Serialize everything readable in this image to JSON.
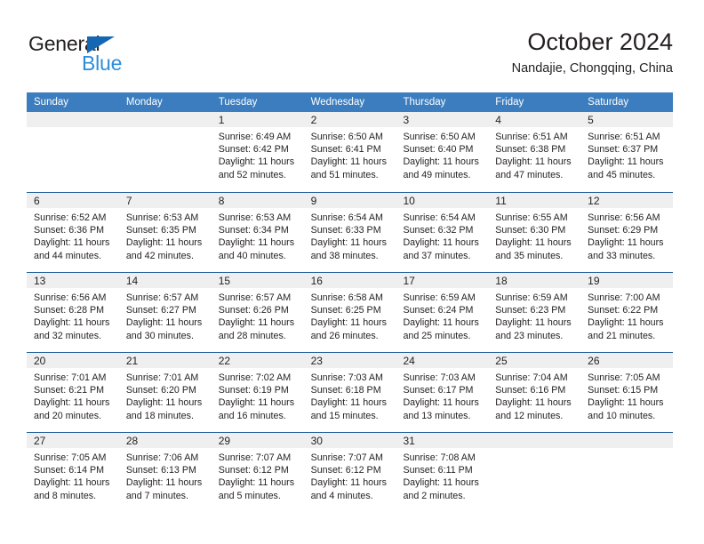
{
  "brand": {
    "name_top": "General",
    "name_bottom": "Blue"
  },
  "header": {
    "title": "October 2024",
    "subtitle": "Nandajie, Chongqing, China"
  },
  "weekdays": [
    "Sunday",
    "Monday",
    "Tuesday",
    "Wednesday",
    "Thursday",
    "Friday",
    "Saturday"
  ],
  "colors": {
    "header_blue": "#3b7dbe",
    "row_divider_blue": "#1f5e9e",
    "daynum_strip": "#efefef",
    "logo_blue": "#2b8ddb",
    "logo_triangle": "#1567b3",
    "text": "#231f20"
  },
  "weeks": [
    [
      {
        "day": "",
        "lines": []
      },
      {
        "day": "",
        "lines": []
      },
      {
        "day": "1",
        "lines": [
          "Sunrise: 6:49 AM",
          "Sunset: 6:42 PM",
          "Daylight: 11 hours",
          "and 52 minutes."
        ]
      },
      {
        "day": "2",
        "lines": [
          "Sunrise: 6:50 AM",
          "Sunset: 6:41 PM",
          "Daylight: 11 hours",
          "and 51 minutes."
        ]
      },
      {
        "day": "3",
        "lines": [
          "Sunrise: 6:50 AM",
          "Sunset: 6:40 PM",
          "Daylight: 11 hours",
          "and 49 minutes."
        ]
      },
      {
        "day": "4",
        "lines": [
          "Sunrise: 6:51 AM",
          "Sunset: 6:38 PM",
          "Daylight: 11 hours",
          "and 47 minutes."
        ]
      },
      {
        "day": "5",
        "lines": [
          "Sunrise: 6:51 AM",
          "Sunset: 6:37 PM",
          "Daylight: 11 hours",
          "and 45 minutes."
        ]
      }
    ],
    [
      {
        "day": "6",
        "lines": [
          "Sunrise: 6:52 AM",
          "Sunset: 6:36 PM",
          "Daylight: 11 hours",
          "and 44 minutes."
        ]
      },
      {
        "day": "7",
        "lines": [
          "Sunrise: 6:53 AM",
          "Sunset: 6:35 PM",
          "Daylight: 11 hours",
          "and 42 minutes."
        ]
      },
      {
        "day": "8",
        "lines": [
          "Sunrise: 6:53 AM",
          "Sunset: 6:34 PM",
          "Daylight: 11 hours",
          "and 40 minutes."
        ]
      },
      {
        "day": "9",
        "lines": [
          "Sunrise: 6:54 AM",
          "Sunset: 6:33 PM",
          "Daylight: 11 hours",
          "and 38 minutes."
        ]
      },
      {
        "day": "10",
        "lines": [
          "Sunrise: 6:54 AM",
          "Sunset: 6:32 PM",
          "Daylight: 11 hours",
          "and 37 minutes."
        ]
      },
      {
        "day": "11",
        "lines": [
          "Sunrise: 6:55 AM",
          "Sunset: 6:30 PM",
          "Daylight: 11 hours",
          "and 35 minutes."
        ]
      },
      {
        "day": "12",
        "lines": [
          "Sunrise: 6:56 AM",
          "Sunset: 6:29 PM",
          "Daylight: 11 hours",
          "and 33 minutes."
        ]
      }
    ],
    [
      {
        "day": "13",
        "lines": [
          "Sunrise: 6:56 AM",
          "Sunset: 6:28 PM",
          "Daylight: 11 hours",
          "and 32 minutes."
        ]
      },
      {
        "day": "14",
        "lines": [
          "Sunrise: 6:57 AM",
          "Sunset: 6:27 PM",
          "Daylight: 11 hours",
          "and 30 minutes."
        ]
      },
      {
        "day": "15",
        "lines": [
          "Sunrise: 6:57 AM",
          "Sunset: 6:26 PM",
          "Daylight: 11 hours",
          "and 28 minutes."
        ]
      },
      {
        "day": "16",
        "lines": [
          "Sunrise: 6:58 AM",
          "Sunset: 6:25 PM",
          "Daylight: 11 hours",
          "and 26 minutes."
        ]
      },
      {
        "day": "17",
        "lines": [
          "Sunrise: 6:59 AM",
          "Sunset: 6:24 PM",
          "Daylight: 11 hours",
          "and 25 minutes."
        ]
      },
      {
        "day": "18",
        "lines": [
          "Sunrise: 6:59 AM",
          "Sunset: 6:23 PM",
          "Daylight: 11 hours",
          "and 23 minutes."
        ]
      },
      {
        "day": "19",
        "lines": [
          "Sunrise: 7:00 AM",
          "Sunset: 6:22 PM",
          "Daylight: 11 hours",
          "and 21 minutes."
        ]
      }
    ],
    [
      {
        "day": "20",
        "lines": [
          "Sunrise: 7:01 AM",
          "Sunset: 6:21 PM",
          "Daylight: 11 hours",
          "and 20 minutes."
        ]
      },
      {
        "day": "21",
        "lines": [
          "Sunrise: 7:01 AM",
          "Sunset: 6:20 PM",
          "Daylight: 11 hours",
          "and 18 minutes."
        ]
      },
      {
        "day": "22",
        "lines": [
          "Sunrise: 7:02 AM",
          "Sunset: 6:19 PM",
          "Daylight: 11 hours",
          "and 16 minutes."
        ]
      },
      {
        "day": "23",
        "lines": [
          "Sunrise: 7:03 AM",
          "Sunset: 6:18 PM",
          "Daylight: 11 hours",
          "and 15 minutes."
        ]
      },
      {
        "day": "24",
        "lines": [
          "Sunrise: 7:03 AM",
          "Sunset: 6:17 PM",
          "Daylight: 11 hours",
          "and 13 minutes."
        ]
      },
      {
        "day": "25",
        "lines": [
          "Sunrise: 7:04 AM",
          "Sunset: 6:16 PM",
          "Daylight: 11 hours",
          "and 12 minutes."
        ]
      },
      {
        "day": "26",
        "lines": [
          "Sunrise: 7:05 AM",
          "Sunset: 6:15 PM",
          "Daylight: 11 hours",
          "and 10 minutes."
        ]
      }
    ],
    [
      {
        "day": "27",
        "lines": [
          "Sunrise: 7:05 AM",
          "Sunset: 6:14 PM",
          "Daylight: 11 hours",
          "and 8 minutes."
        ]
      },
      {
        "day": "28",
        "lines": [
          "Sunrise: 7:06 AM",
          "Sunset: 6:13 PM",
          "Daylight: 11 hours",
          "and 7 minutes."
        ]
      },
      {
        "day": "29",
        "lines": [
          "Sunrise: 7:07 AM",
          "Sunset: 6:12 PM",
          "Daylight: 11 hours",
          "and 5 minutes."
        ]
      },
      {
        "day": "30",
        "lines": [
          "Sunrise: 7:07 AM",
          "Sunset: 6:12 PM",
          "Daylight: 11 hours",
          "and 4 minutes."
        ]
      },
      {
        "day": "31",
        "lines": [
          "Sunrise: 7:08 AM",
          "Sunset: 6:11 PM",
          "Daylight: 11 hours",
          "and 2 minutes."
        ]
      },
      {
        "day": "",
        "lines": []
      },
      {
        "day": "",
        "lines": []
      }
    ]
  ]
}
